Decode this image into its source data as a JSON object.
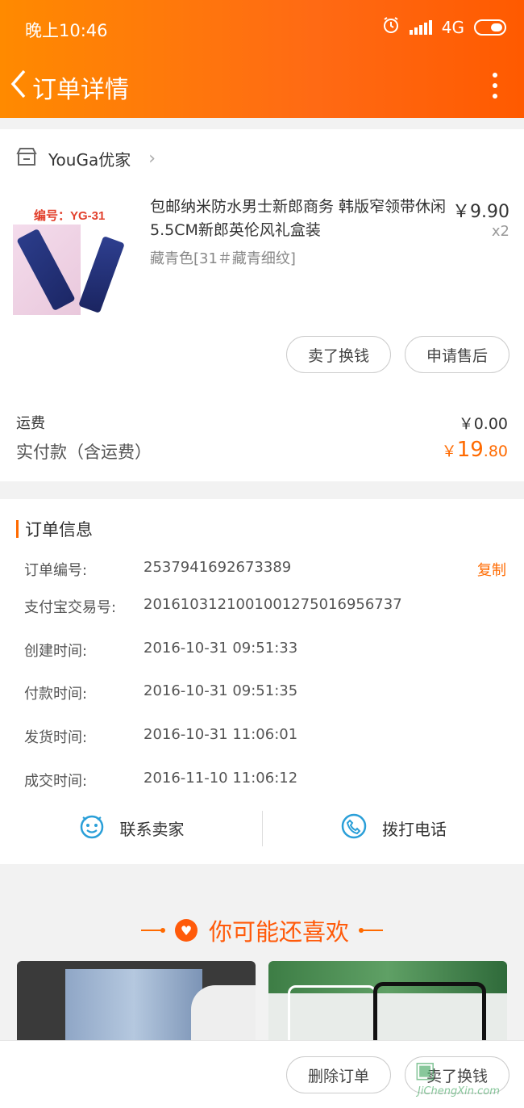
{
  "status_bar": {
    "time": "晚上10:46",
    "network": "4G"
  },
  "nav": {
    "title": "订单详情"
  },
  "shop": {
    "name": "YouGa优家"
  },
  "product": {
    "code_text": "编号：YG-31",
    "title": "包邮纳米防水男士新郎商务 韩版窄领带休闲5.5CM新郎英伦风礼盒装",
    "spec": "藏青色[31＃藏青细纹]",
    "price": "￥9.90",
    "quantity": "x2"
  },
  "actions": {
    "swap": "卖了换钱",
    "after_sale": "申请售后"
  },
  "fees": {
    "shipping_label": "运费",
    "shipping_value": "￥0.00",
    "paid_label": "实付款（含运费）",
    "paid_currency": "￥",
    "paid_int": "19",
    "paid_dec": ".80"
  },
  "order_info": {
    "heading": "订单信息",
    "copy_label": "复制",
    "rows": [
      {
        "label": "订单编号:",
        "value": "2537941692673389"
      },
      {
        "label": "支付宝交易号:",
        "value": "2016103121001001275016956737"
      },
      {
        "label": "创建时间:",
        "value": "2016-10-31 09:51:33"
      },
      {
        "label": "付款时间:",
        "value": "2016-10-31 09:51:35"
      },
      {
        "label": "发货时间:",
        "value": "2016-10-31 11:06:01"
      },
      {
        "label": "成交时间:",
        "value": "2016-11-10 11:06:12"
      }
    ]
  },
  "contact": {
    "seller": "联系卖家",
    "call": "拨打电话"
  },
  "recommend": {
    "heading": "你可能还喜欢"
  },
  "bottom_actions": {
    "delete": "删除订单",
    "swap": "卖了换钱"
  },
  "watermark": {
    "site": "JiChengXin.com"
  },
  "colors": {
    "accent": "#ff6a00",
    "header_start": "#ff8a00",
    "header_end": "#ff5a00"
  }
}
